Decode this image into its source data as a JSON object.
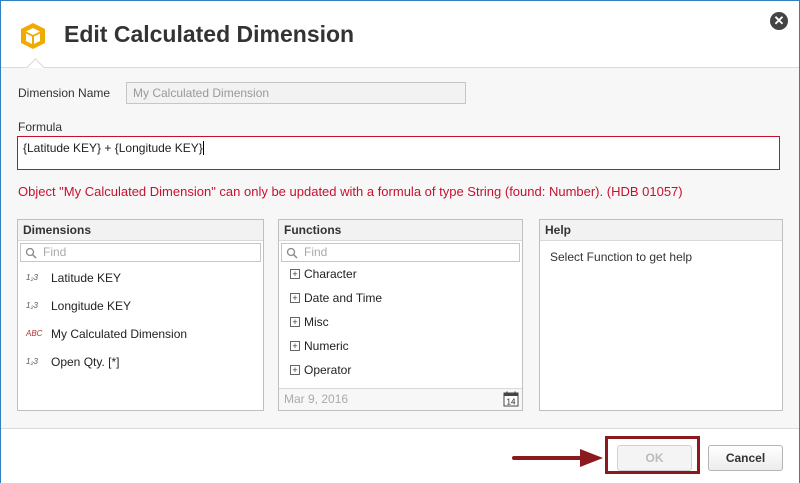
{
  "dialog": {
    "title": "Edit Calculated Dimension",
    "close_icon": "close-icon",
    "logo_icon": "cube-logo-icon",
    "accent_color": "#f0ab00",
    "border_color": "#2f7fc1"
  },
  "dimension_name": {
    "label": "Dimension Name",
    "placeholder": "My Calculated Dimension"
  },
  "formula": {
    "label": "Formula",
    "value": "{Latitude KEY} + {Longitude KEY}"
  },
  "error": {
    "message": "Object \"My Calculated Dimension\" can only be updated with a formula of type String (found: Number). (HDB 01057)",
    "color": "#c8102e"
  },
  "dimensions_panel": {
    "title": "Dimensions",
    "search_placeholder": "Find",
    "items": [
      {
        "type": "1₂3",
        "label": "Latitude KEY"
      },
      {
        "type": "1₂3",
        "label": "Longitude KEY"
      },
      {
        "type": "ABC",
        "label": "My Calculated Dimension"
      },
      {
        "type": "1₂3",
        "label": "Open Qty. [*]"
      }
    ]
  },
  "functions_panel": {
    "title": "Functions",
    "search_placeholder": "Find",
    "items": [
      {
        "label": "Character"
      },
      {
        "label": "Date and Time"
      },
      {
        "label": "Misc"
      },
      {
        "label": "Numeric"
      },
      {
        "label": "Operator"
      }
    ],
    "date_value": "Mar 9, 2016",
    "calendar_day": "14"
  },
  "help_panel": {
    "title": "Help",
    "text": "Select Function to get help"
  },
  "footer": {
    "ok_label": "OK",
    "cancel_label": "Cancel",
    "annotation_color": "#8b1a1f"
  }
}
